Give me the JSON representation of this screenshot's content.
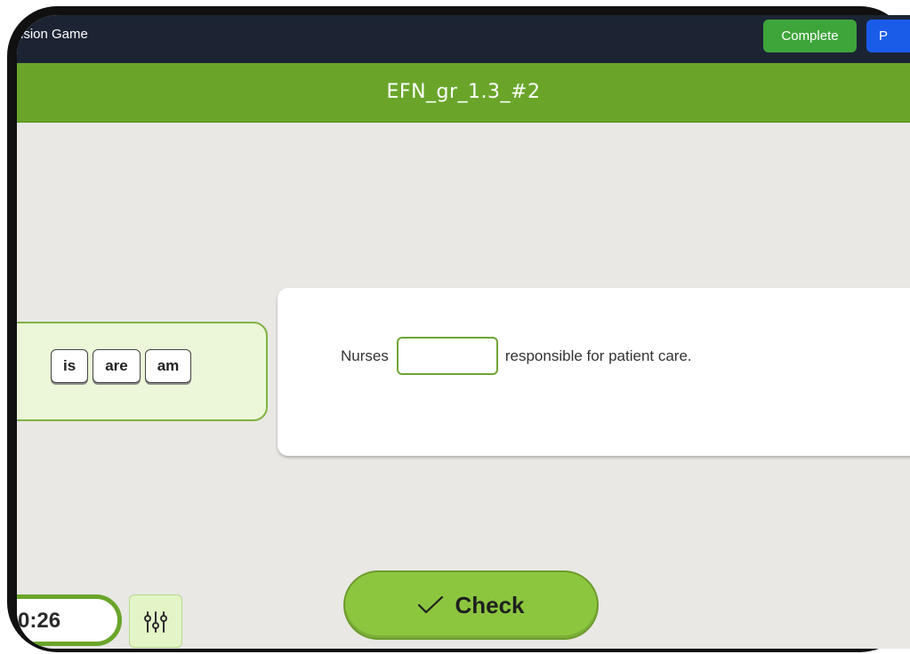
{
  "topbar": {
    "app_title": "ision Game",
    "complete_label": "Complete",
    "blue_button_label": "P"
  },
  "header": {
    "title": "EFN_gr_1.3_#2"
  },
  "word_bank": {
    "chips": [
      "is",
      "are",
      "am"
    ]
  },
  "question": {
    "before": "Nurses",
    "blank_value": "",
    "after": "responsible for patient care."
  },
  "timer": {
    "value": "0:26"
  },
  "settings": {
    "icon": "sliders-icon"
  },
  "check": {
    "label": "Check",
    "icon": "checkmark-icon"
  },
  "colors": {
    "topbar": "#1c2434",
    "header_green": "#6aa52a",
    "complete_green": "#3ea53a",
    "blue": "#1a5be8",
    "check_green": "#8cc63f",
    "background": "#e9e8e5"
  }
}
